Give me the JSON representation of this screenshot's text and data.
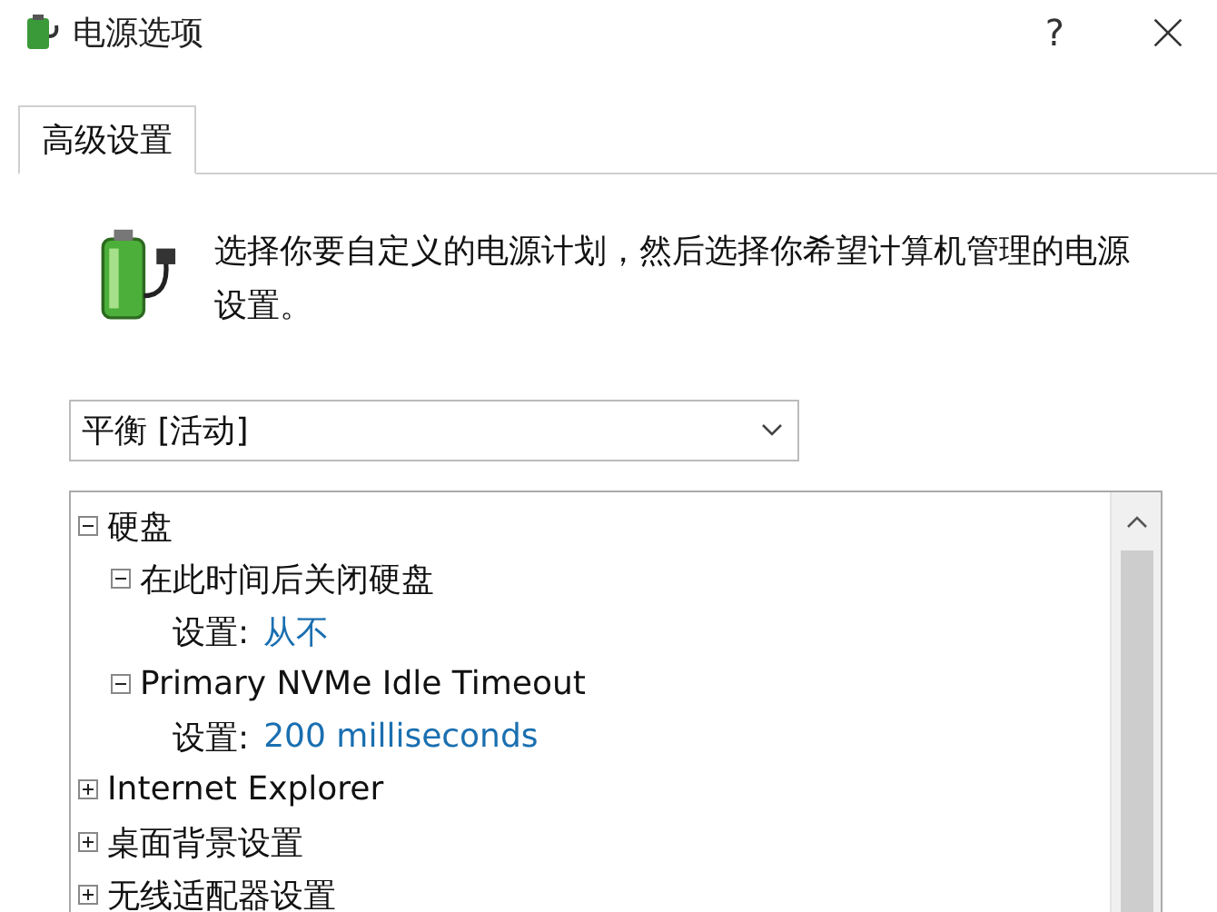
{
  "window": {
    "title": "电源选项",
    "help": "?"
  },
  "tabs": [
    {
      "label": "高级设置",
      "selected": true
    }
  ],
  "description": "选择你要自定义的电源计划，然后选择你希望计算机管理的电源设置。",
  "plan_dropdown": {
    "value": "平衡 [活动]"
  },
  "tree": [
    {
      "kind": "group",
      "label": "硬盘",
      "expanded": true,
      "children": [
        {
          "kind": "group",
          "label": "在此时间后关闭硬盘",
          "expanded": true,
          "children": [
            {
              "kind": "setting",
              "label": "设置:",
              "value": "从不"
            }
          ]
        },
        {
          "kind": "group",
          "label": "Primary NVMe Idle Timeout",
          "expanded": true,
          "children": [
            {
              "kind": "setting",
              "label": "设置:",
              "value": "200 milliseconds"
            }
          ]
        }
      ]
    },
    {
      "kind": "group",
      "label": "Internet Explorer",
      "expanded": false
    },
    {
      "kind": "group",
      "label": "桌面背景设置",
      "expanded": false
    },
    {
      "kind": "group",
      "label": "无线适配器设置",
      "expanded": false
    }
  ]
}
